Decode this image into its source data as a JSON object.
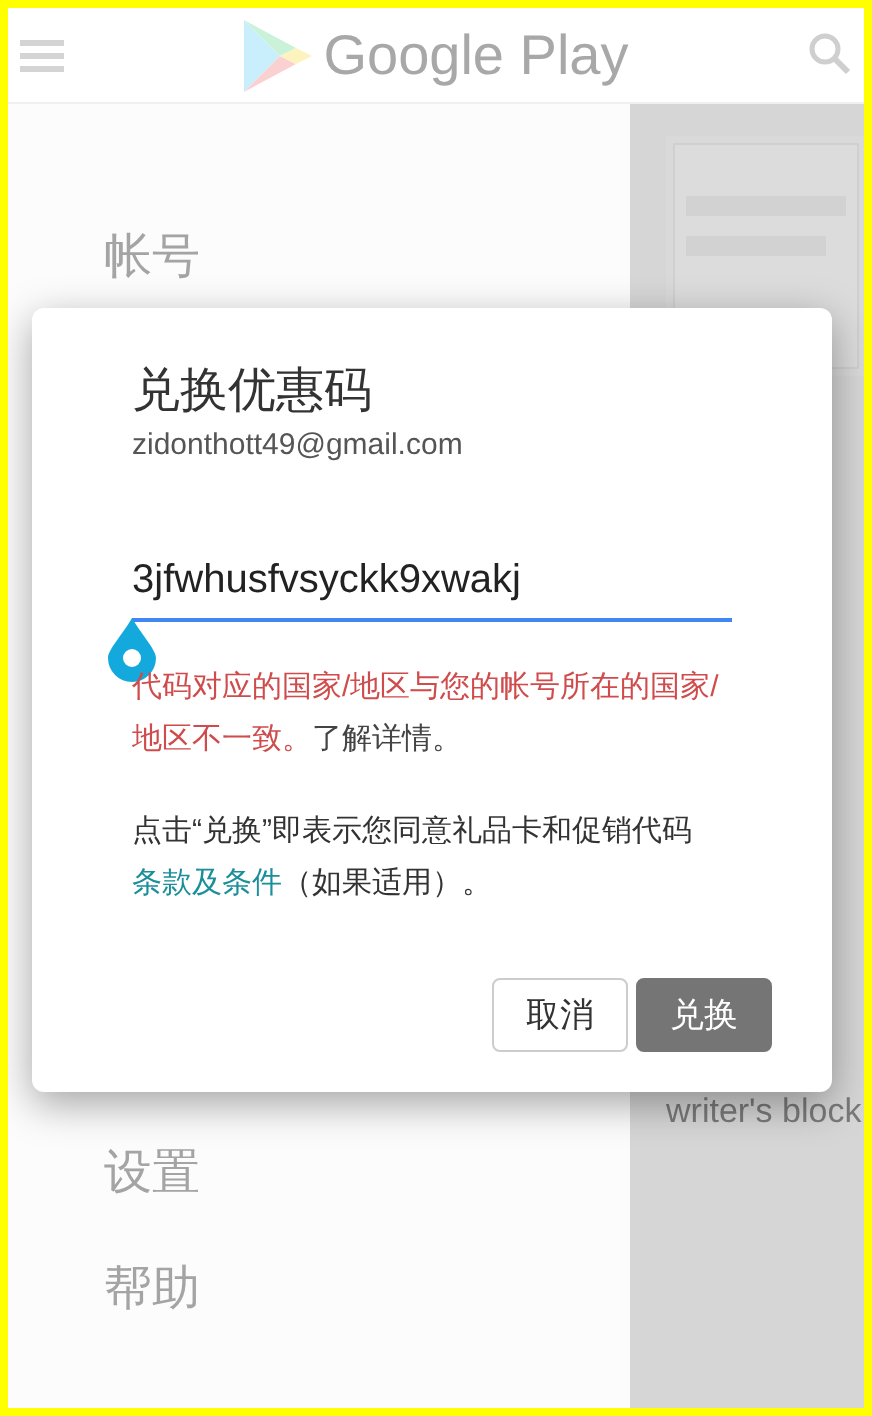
{
  "app_bar": {
    "logo_text": "Google Play"
  },
  "drawer": {
    "items": [
      {
        "label": "帐号"
      },
      {
        "label": "设置"
      },
      {
        "label": "帮助"
      }
    ]
  },
  "content": {
    "snippet": "writer's block"
  },
  "dialog": {
    "title": "兑换优惠码",
    "account": "zidonthott49@gmail.com",
    "code_field": {
      "value": "3jfwhusfvsyckk9xwakj",
      "focused": true
    },
    "error": {
      "message": "代码对应的国家/地区与您的帐号所在的国家/地区不一致。",
      "link": "了解详情。"
    },
    "terms": {
      "before": "点击“兑换”即表示您同意礼品卡和促销代码",
      "link": "条款及条件",
      "after": "（如果适用）。"
    },
    "buttons": [
      {
        "label": "取消",
        "kind": "secondary"
      },
      {
        "label": "兑换",
        "kind": "primary"
      }
    ]
  }
}
